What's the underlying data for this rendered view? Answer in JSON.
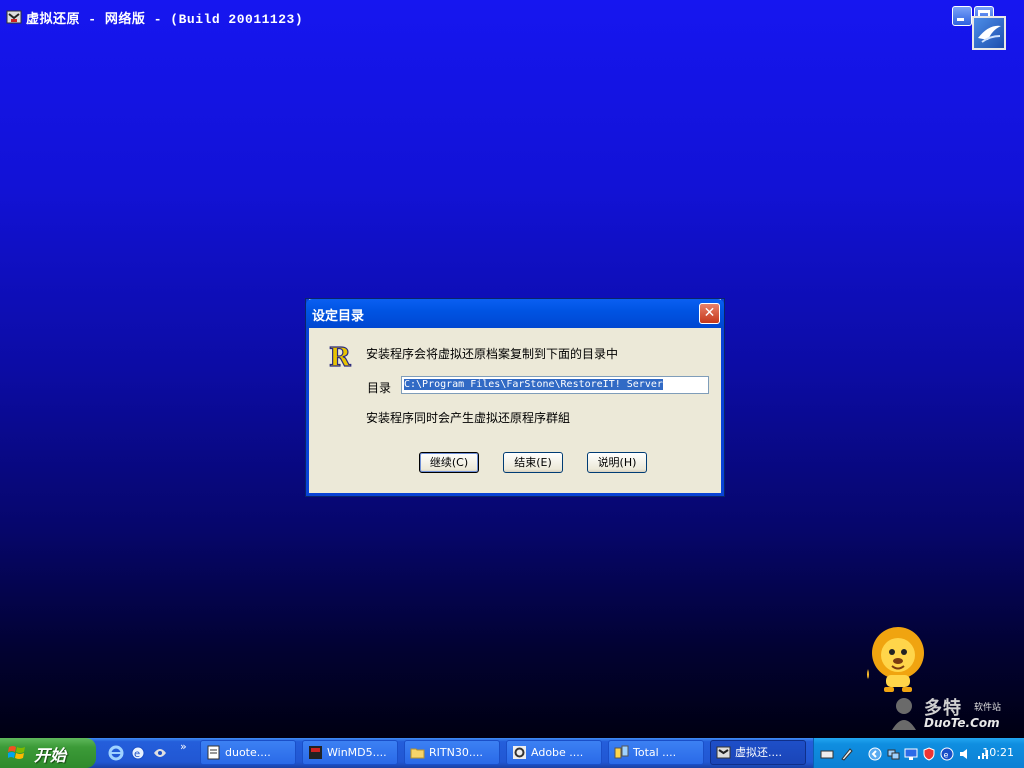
{
  "window": {
    "title": "虚拟还原 - 网络版 - (Build 20011123)"
  },
  "dialog": {
    "title": "设定目录",
    "close_label": "✕",
    "message1": "安装程序会将虚拟还原档案复制到下面的目录中",
    "dir_label": "目录",
    "dir_value": "C:\\Program Files\\FarStone\\RestoreIT! Server",
    "message2": "安装程序同时会产生虚拟还原程序群組",
    "buttons": {
      "continue": "继续(C)",
      "finish": "结束(E)",
      "help": "说明(H)"
    }
  },
  "watermark": {
    "title": "多特",
    "small": "软件站",
    "site": "DuoTe.Com"
  },
  "taskbar": {
    "start_label": "开始",
    "chevron": "»",
    "tasks": [
      {
        "label": "duote...."
      },
      {
        "label": "WinMD5...."
      },
      {
        "label": "RITN30...."
      },
      {
        "label": "Adobe ...."
      },
      {
        "label": "Total ...."
      },
      {
        "label": "虚拟还...."
      }
    ],
    "clock": "10:21"
  },
  "colors": {
    "desktop_top": "#1616f0",
    "desktop_bottom": "#000012",
    "dialog_face": "#ece9d8",
    "title_blue": "#0054e3",
    "selection": "#316ac5"
  }
}
